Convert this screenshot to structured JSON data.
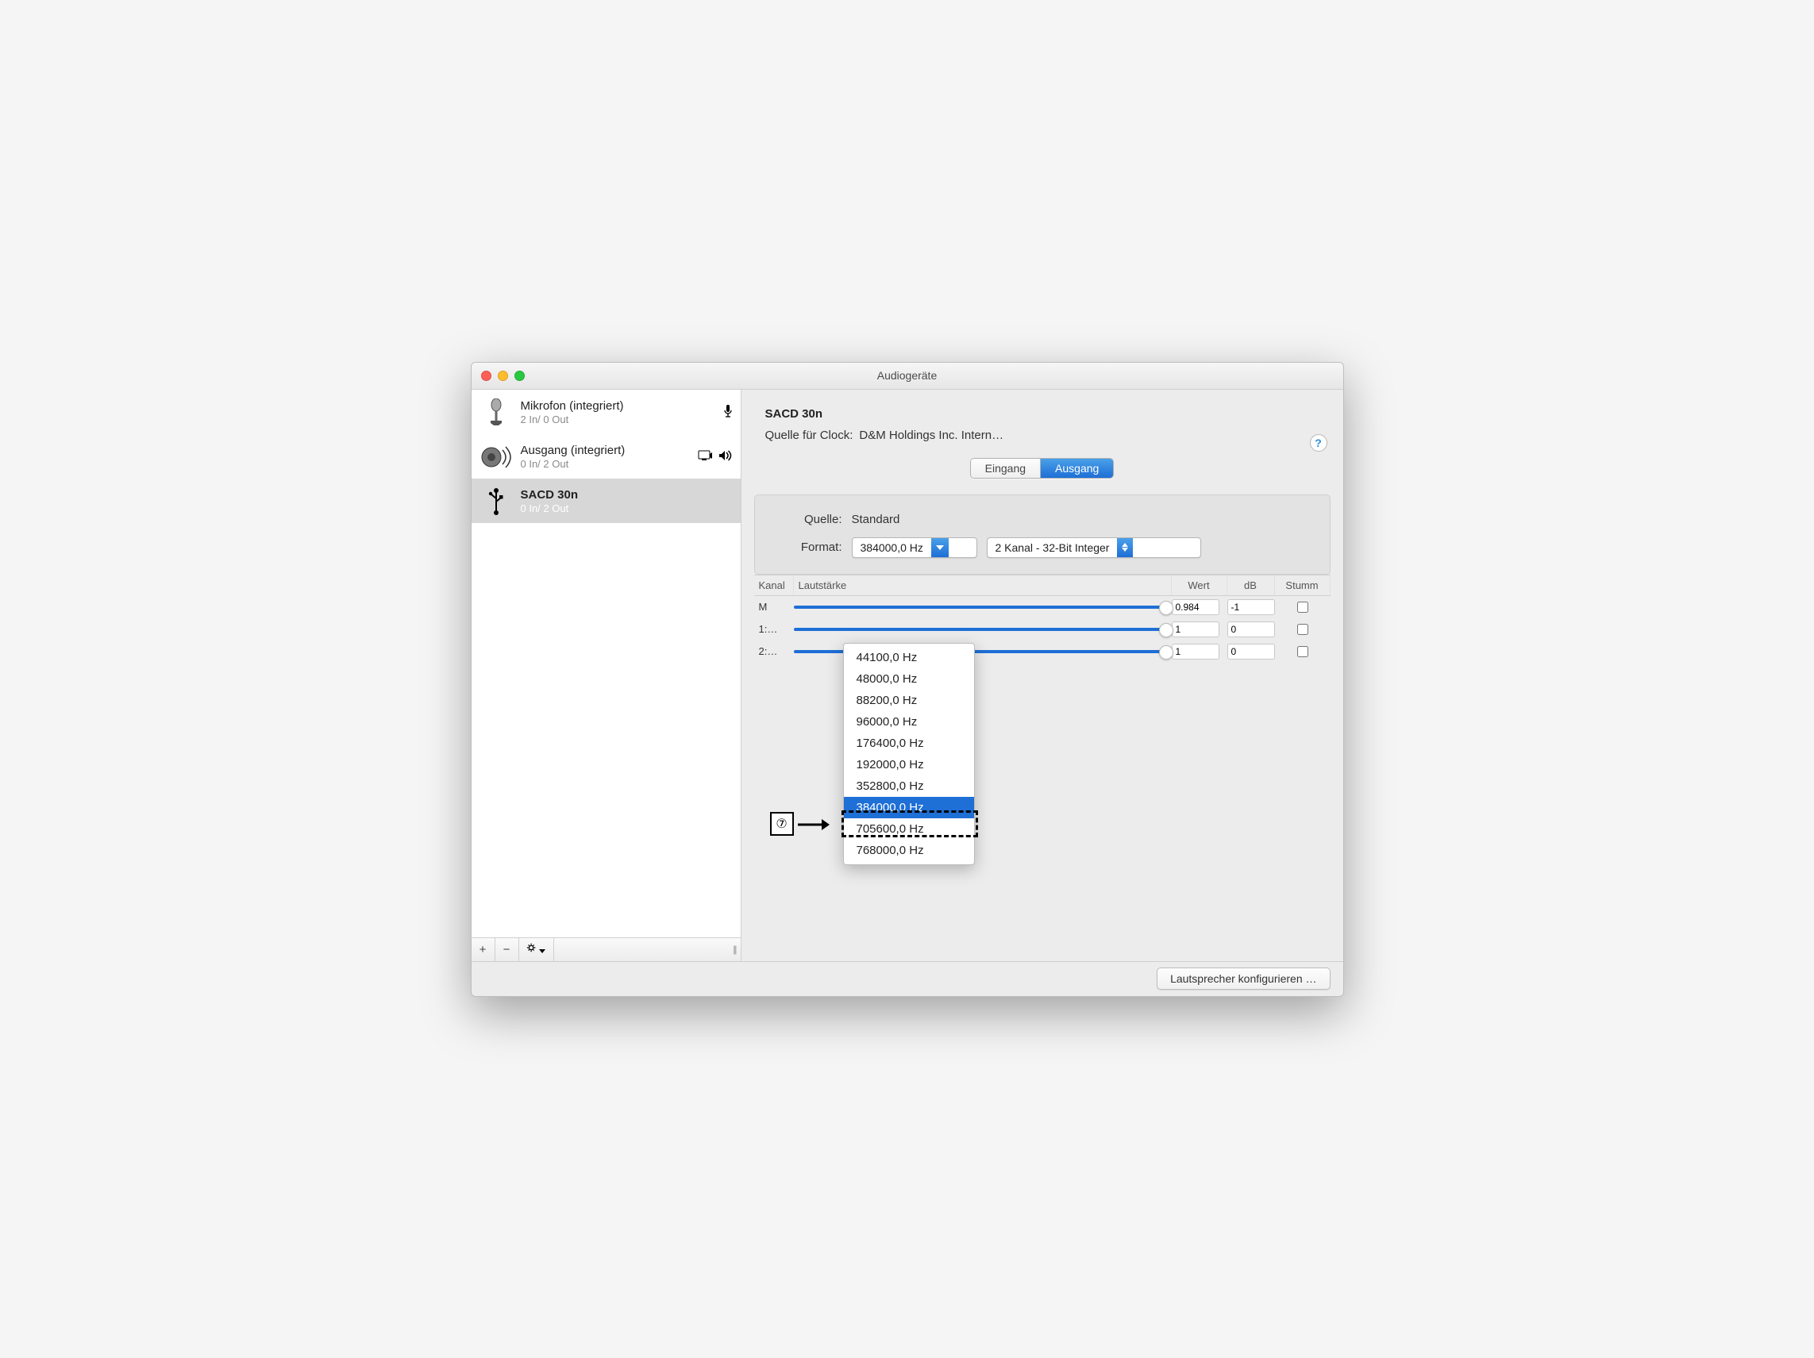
{
  "window_title": "Audiogeräte",
  "sidebar": {
    "devices": [
      {
        "icon": "microphone",
        "name": "Mikrofon (integriert)",
        "io": "2 In/ 0 Out",
        "badges": [
          "mic"
        ],
        "selected": false
      },
      {
        "icon": "speaker",
        "name": "Ausgang (integriert)",
        "io": "0 In/ 2 Out",
        "badges": [
          "system-out",
          "sound-out"
        ],
        "selected": false
      },
      {
        "icon": "usb",
        "name": "SACD 30n",
        "io": "0 In/ 2 Out",
        "badges": [],
        "selected": true
      }
    ],
    "footer": {
      "add": "+",
      "remove": "−",
      "gear": "✻"
    }
  },
  "main": {
    "title": "SACD 30n",
    "clock_label": "Quelle für Clock:",
    "clock_value": "D&M Holdings Inc. Intern…",
    "help": "?",
    "tabs": {
      "in": "Eingang",
      "out": "Ausgang",
      "active": "out"
    },
    "panel": {
      "quelle_label": "Quelle:",
      "quelle_value": "Standard",
      "format_label": "Format:",
      "rate_selected": "384000,0 Hz",
      "rate_options": [
        "44100,0 Hz",
        "48000,0 Hz",
        "88200,0 Hz",
        "96000,0 Hz",
        "176400,0 Hz",
        "192000,0 Hz",
        "352800,0 Hz",
        "384000,0 Hz",
        "705600,0 Hz",
        "768000,0 Hz"
      ],
      "channel_selected": "2 Kanal - 32-Bit Integer"
    },
    "table": {
      "head": {
        "kanal": "Kanal",
        "vol": "Lautstärke",
        "wert": "Wert",
        "db": "dB",
        "stumm": "Stumm"
      },
      "rows": [
        {
          "ch": "M",
          "wert": "0.984",
          "db": "-1",
          "stumm": false
        },
        {
          "ch": "1:…",
          "wert": "1",
          "db": "0",
          "stumm": false
        },
        {
          "ch": "2:…",
          "wert": "1",
          "db": "0",
          "stumm": false
        }
      ]
    },
    "footer_button": "Lautsprecher konfigurieren …"
  },
  "callout": {
    "num": "⑦"
  }
}
